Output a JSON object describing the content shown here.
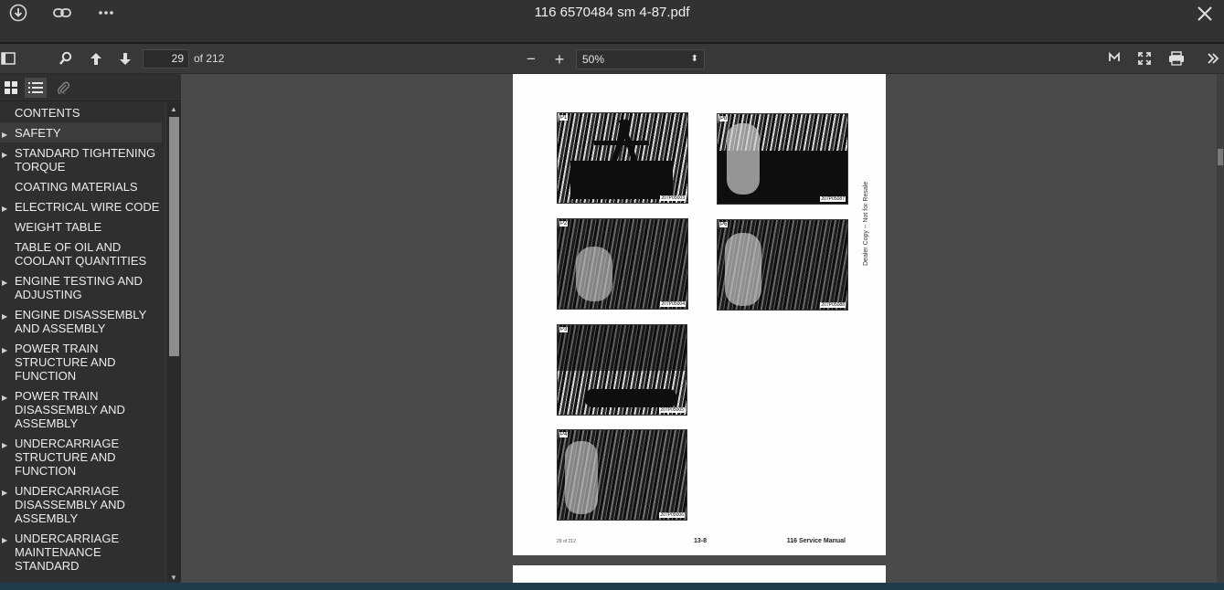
{
  "window": {
    "title": "116 6570484 sm 4-87.pdf"
  },
  "titlebar": {
    "download_icon": "download-icon",
    "link_icon": "link-icon",
    "more_icon": "more-icon",
    "close_icon": "close-icon"
  },
  "toolbar": {
    "page_number": "29",
    "page_of": "of 212",
    "zoom": "50%",
    "zoom_out": "−",
    "zoom_in": "+"
  },
  "sidebar": {
    "outline": [
      {
        "label": "CONTENTS",
        "has_children": false
      },
      {
        "label": "SAFETY",
        "has_children": true
      },
      {
        "label": "STANDARD TIGHTENING TORQUE",
        "has_children": true
      },
      {
        "label": "COATING MATERIALS",
        "has_children": false
      },
      {
        "label": "ELECTRICAL WIRE CODE",
        "has_children": true
      },
      {
        "label": "WEIGHT TABLE",
        "has_children": false
      },
      {
        "label": "TABLE OF OIL AND COOLANT QUANTITIES",
        "has_children": false
      },
      {
        "label": "ENGINE TESTING AND ADJUSTING",
        "has_children": true
      },
      {
        "label": "ENGINE DISASSEMBLY AND ASSEMBLY",
        "has_children": true
      },
      {
        "label": "POWER TRAIN STRUCTURE AND FUNCTION",
        "has_children": true
      },
      {
        "label": "POWER TRAIN DISASSEMBLY AND ASSEMBLY",
        "has_children": true
      },
      {
        "label": "UNDERCARRIAGE STRUCTURE AND FUNCTION",
        "has_children": true
      },
      {
        "label": "UNDERCARRIAGE DISASSEMBLY AND ASSEMBLY",
        "has_children": true
      },
      {
        "label": "UNDERCARRIAGE MAINTENANCE STANDARD",
        "has_children": true
      }
    ]
  },
  "document": {
    "photos": [
      {
        "label": "P1",
        "code": "207P05003"
      },
      {
        "label": "Pb",
        "code": "207P05087"
      },
      {
        "label": "P2",
        "code": "207P05004"
      },
      {
        "label": "P6",
        "code": "207P05088"
      },
      {
        "label": "P3",
        "code": "207P05005"
      },
      {
        "label": "P4",
        "code": "207P05006"
      }
    ],
    "footer_left": "29 of 212",
    "footer_center": "13-8",
    "footer_right": "116 Service Manual",
    "side_text": "Dealer Copy -- Not for Resale"
  }
}
